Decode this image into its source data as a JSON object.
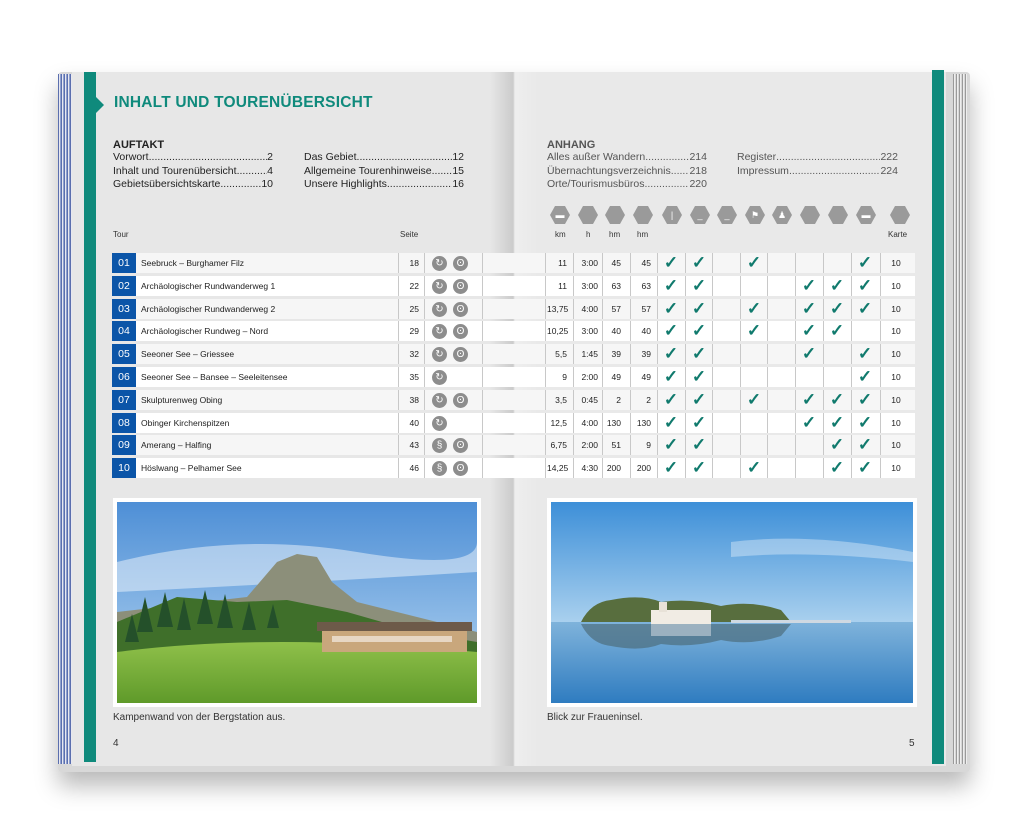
{
  "title": "INHALT UND TOURENÜBERSICHT",
  "left_section": {
    "heading": "AUFTAKT",
    "col1": [
      {
        "label": "Vorwort",
        "page": "2"
      },
      {
        "label": "Inhalt und Tourenübersicht",
        "page": "4"
      },
      {
        "label": "Gebietsübersichtskarte",
        "page": "10"
      }
    ],
    "col2": [
      {
        "label": "Das Gebiet",
        "page": "12"
      },
      {
        "label": "Allgemeine Tourenhinweise",
        "page": "15"
      },
      {
        "label": "Unsere Highlights",
        "page": "16"
      }
    ]
  },
  "right_section": {
    "heading": "ANHANG",
    "col1": [
      {
        "label": "Alles außer Wandern",
        "page": "214"
      },
      {
        "label": "Übernachtungsverzeichnis",
        "page": "218"
      },
      {
        "label": "Orte/Tourismusbüros",
        "page": "220"
      }
    ],
    "col2": [
      {
        "label": "Register",
        "page": "222"
      },
      {
        "label": "Impressum",
        "page": "224"
      }
    ]
  },
  "table": {
    "headers": {
      "tour": "Tour",
      "seite": "Seite",
      "km": "km",
      "h": "h",
      "hm1": "hm",
      "hm2": "hm",
      "karte": "Karte"
    },
    "check_symbol": "✓",
    "rows": [
      {
        "num": "01",
        "name": "Seebruck – Burghamer Filz",
        "seite": "18",
        "icons": [
          "ring",
          "bear"
        ],
        "km": "11",
        "h": "3:00",
        "hm1": "45",
        "hm2": "45",
        "checks": [
          1,
          1,
          0,
          1,
          0,
          0,
          0,
          1
        ],
        "karte": "10"
      },
      {
        "num": "02",
        "name": "Archäologischer Rundwanderweg 1",
        "seite": "22",
        "icons": [
          "ring",
          "bear"
        ],
        "km": "11",
        "h": "3:00",
        "hm1": "63",
        "hm2": "63",
        "checks": [
          1,
          1,
          0,
          0,
          0,
          1,
          1,
          1
        ],
        "karte": "10"
      },
      {
        "num": "03",
        "name": "Archäologischer Rundwanderweg 2",
        "seite": "25",
        "icons": [
          "ring",
          "bear"
        ],
        "km": "13,75",
        "h": "4:00",
        "hm1": "57",
        "hm2": "57",
        "checks": [
          1,
          1,
          0,
          1,
          0,
          1,
          1,
          1
        ],
        "karte": "10"
      },
      {
        "num": "04",
        "name": "Archäologischer Rundweg – Nord",
        "seite": "29",
        "icons": [
          "ring",
          "bear"
        ],
        "km": "10,25",
        "h": "3:00",
        "hm1": "40",
        "hm2": "40",
        "checks": [
          1,
          1,
          0,
          1,
          0,
          1,
          1,
          0
        ],
        "karte": "10"
      },
      {
        "num": "05",
        "name": "Seeoner See – Griessee",
        "seite": "32",
        "icons": [
          "ring",
          "bear"
        ],
        "km": "5,5",
        "h": "1:45",
        "hm1": "39",
        "hm2": "39",
        "checks": [
          1,
          1,
          0,
          0,
          0,
          1,
          0,
          1
        ],
        "karte": "10"
      },
      {
        "num": "06",
        "name": "Seeoner See – Bansee – Seeleitensee",
        "seite": "35",
        "icons": [
          "ring"
        ],
        "km": "9",
        "h": "2:00",
        "hm1": "49",
        "hm2": "49",
        "checks": [
          1,
          1,
          0,
          0,
          0,
          0,
          0,
          1
        ],
        "karte": "10"
      },
      {
        "num": "07",
        "name": "Skulpturenweg Obing",
        "seite": "38",
        "icons": [
          "ring",
          "bear"
        ],
        "km": "3,5",
        "h": "0:45",
        "hm1": "2",
        "hm2": "2",
        "checks": [
          1,
          1,
          0,
          1,
          0,
          1,
          1,
          1
        ],
        "karte": "10"
      },
      {
        "num": "08",
        "name": "Obinger Kirchenspitzen",
        "seite": "40",
        "icons": [
          "ring"
        ],
        "km": "12,5",
        "h": "4:00",
        "hm1": "130",
        "hm2": "130",
        "checks": [
          1,
          1,
          0,
          0,
          0,
          1,
          1,
          1
        ],
        "karte": "10"
      },
      {
        "num": "09",
        "name": "Amerang – Halfing",
        "seite": "43",
        "icons": [
          "route",
          "bear"
        ],
        "km": "6,75",
        "h": "2:00",
        "hm1": "51",
        "hm2": "9",
        "checks": [
          1,
          1,
          0,
          0,
          0,
          0,
          1,
          1
        ],
        "karte": "10"
      },
      {
        "num": "10",
        "name": "Höslwang – Pelhamer See",
        "seite": "46",
        "icons": [
          "route",
          "bear"
        ],
        "km": "14,25",
        "h": "4:30",
        "hm1": "200",
        "hm2": "200",
        "checks": [
          1,
          1,
          0,
          1,
          0,
          0,
          1,
          1
        ],
        "karte": "10"
      }
    ]
  },
  "header_icons": [
    "minus-icon",
    "blank-icon",
    "blank-icon",
    "blank-icon",
    "sign-icon",
    "bench-icon",
    "bench-icon",
    "flag-icon",
    "person-icon",
    "blank-icon",
    "blank-icon",
    "minus-icon",
    "blank-icon"
  ],
  "photos": {
    "left_caption": "Kampenwand von der Bergstation aus.",
    "right_caption": "Blick zur Fraueninsel."
  },
  "page_numbers": {
    "left": "4",
    "right": "5"
  },
  "colors": {
    "teal": "#0f8a7c",
    "blue": "#0b55a8",
    "check": "#107a6d"
  }
}
